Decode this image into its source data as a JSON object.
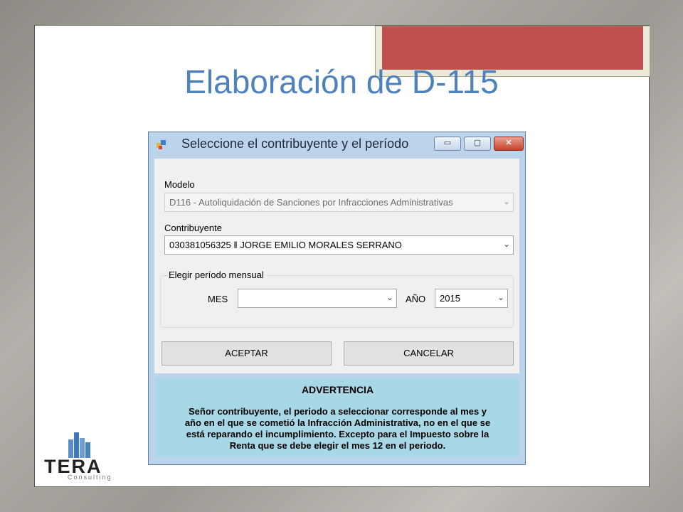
{
  "slide": {
    "title": "Elaboración de D-115"
  },
  "window": {
    "title": "Seleccione el contribuyente y el período",
    "controls": {
      "minimize": "▭",
      "maximize": "▢",
      "close": "✕"
    }
  },
  "form": {
    "modelo_label": "Modelo",
    "modelo_value": "D116 - Autoliquidación de Sanciones por Infracciones Administrativas",
    "contribuyente_label": "Contribuyente",
    "contribuyente_value": "030381056325 ‖ JORGE EMILIO MORALES SERRANO",
    "periodo_group": "Elegir período mensual",
    "mes_label": "MES",
    "mes_value": "",
    "anio_label": "AÑO",
    "anio_value": "2015",
    "dropdown_arrow": "⌄"
  },
  "buttons": {
    "accept": "ACEPTAR",
    "cancel": "CANCELAR"
  },
  "warning": {
    "title": "ADVERTENCIA",
    "line1": "Señor contribuyente, el periodo a seleccionar corresponde al mes y",
    "line2": "año en el que se cometió la Infracción Administrativa, no en el que se",
    "line3": "está reparando el incumplimiento. Excepto para el Impuesto sobre la",
    "line4": "Renta que se debe elegir el mes 12 en el periodo."
  },
  "logo": {
    "name": "TERA",
    "sub": "Consulting"
  },
  "colors": {
    "title": "#4f81bd",
    "accent_tab": "#c0504d",
    "warning_bg": "#a8d8e6"
  }
}
